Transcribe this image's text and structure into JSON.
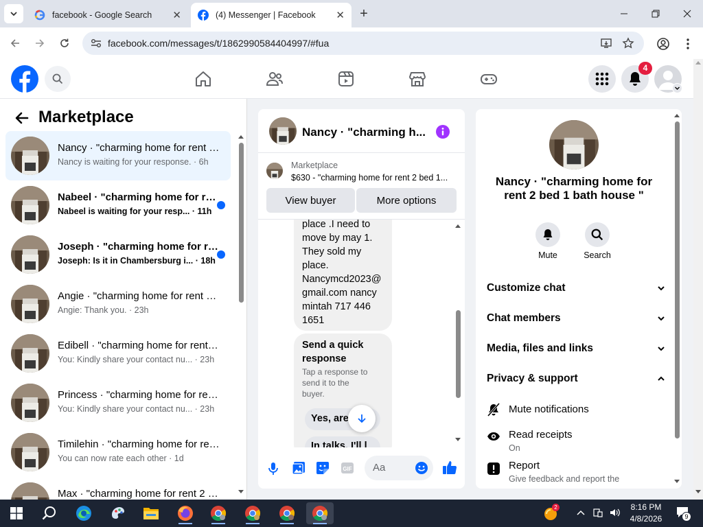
{
  "browser": {
    "tabs": [
      {
        "title": "facebook - Google Search"
      },
      {
        "title": "(4) Messenger | Facebook"
      }
    ],
    "url": "facebook.com/messages/t/1862990584404997/#fua"
  },
  "fb_header": {
    "notification_count": "4"
  },
  "sidebar": {
    "title": "Marketplace",
    "conversations": [
      {
        "name": "Nancy · \"charming home for rent 2 bed 1 bath house \"",
        "preview": "Nancy is waiting for your response. · 6h",
        "unread": false
      },
      {
        "name": "Nabeel · \"charming home for rent 2 bed 1 bath house \"",
        "preview": "Nabeel is waiting for your resp... · 11h",
        "unread": true
      },
      {
        "name": "Joseph · \"charming home for rent 2 bed 1 bath house \"",
        "preview": "Joseph: Is it in Chambersburg i... · 18h",
        "unread": true
      },
      {
        "name": "Angie · \"charming home for rent 2 bed 1 bath house \"",
        "preview": "Angie: Thank you. · 23h",
        "unread": false
      },
      {
        "name": "Edibell · \"charming home for rent 2 bed 1 bath house \"",
        "preview": "You: Kindly share your contact nu...  · 23h",
        "unread": false
      },
      {
        "name": "Princess · \"charming home for rent 2 bed 1 bath house \"",
        "preview": "You: Kindly share your contact nu...  · 23h",
        "unread": false
      },
      {
        "name": "Timilehin · \"charming home for rent 2 bed 1 bath house \"",
        "preview": "You can now rate each other · 1d",
        "unread": false
      },
      {
        "name": "Max · \"charming home for rent 2 bed 1 bath house \"",
        "preview": "",
        "unread": false
      }
    ]
  },
  "chat": {
    "header_title": "Nancy · \"charming h...",
    "listing_label": "Marketplace",
    "listing_title": "$630 - \"charming home for rent 2 bed 1...",
    "view_buyer": "View buyer",
    "more_options": "More options",
    "message_lines": [
      "place .I need to",
      "move by may 1.",
      "They sold my",
      "place.",
      "Nancymcd2023@",
      "gmail.com nancy",
      "mintah 717 446",
      "1651"
    ],
    "quick_title_lines": [
      "Send a quick",
      "response"
    ],
    "quick_sub_lines": [
      "Tap a response to",
      "send it to the",
      "buyer."
    ],
    "quick_replies": [
      "Yes, are",
      "In talks. I'll l"
    ],
    "input_placeholder": "Aa"
  },
  "details": {
    "title_line1": "Nancy · \"charming home for",
    "title_line2": "rent 2 bed 1 bath house \"",
    "mute": "Mute",
    "search": "Search",
    "sections": [
      "Customize chat",
      "Chat members",
      "Media, files and links",
      "Privacy & support"
    ],
    "mute_notifications": "Mute notifications",
    "read_receipts": "Read receipts",
    "read_receipts_status": "On",
    "report": "Report",
    "report_sub": "Give feedback and report the"
  },
  "taskbar": {
    "time": "8:16 PM",
    "date": "4/8/2026",
    "notification_count": "9",
    "app_badge": "2"
  },
  "colors": {
    "fb_blue": "#0866ff",
    "messenger_purple": "#a033ff",
    "notification_red": "#e41e3f",
    "selected_row": "#ebf5ff"
  }
}
